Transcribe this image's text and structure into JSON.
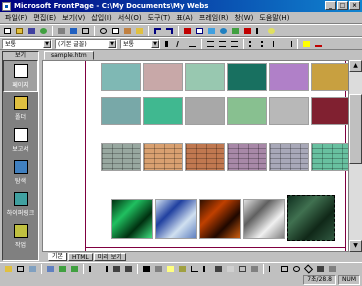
{
  "window": {
    "title": "Microsoft FrontPage - C:\\My Documents\\My Webs",
    "min": "_",
    "max": "□",
    "close": "×"
  },
  "menu": [
    "파일(F)",
    "편집(E)",
    "보기(V)",
    "삽입(I)",
    "서식(O)",
    "도구(T)",
    "표(A)",
    "프레임(R)",
    "창(W)",
    "도움말(H)"
  ],
  "format": {
    "style": "보통",
    "font": "(기본 글꼴)",
    "size": "보통"
  },
  "views": {
    "title": "보기",
    "items": [
      "페이지",
      "폴더",
      "보고서",
      "탐색",
      "하이퍼링크",
      "작업"
    ]
  },
  "document": {
    "tab": "sample.htm",
    "view_tabs": [
      "기본",
      "HTML",
      "미리 보기"
    ]
  },
  "status": {
    "time": "7초/28.8",
    "mode": "NUM"
  },
  "colors": {
    "title_start": "#000080",
    "title_end": "#1084d0",
    "border": "#800040"
  }
}
